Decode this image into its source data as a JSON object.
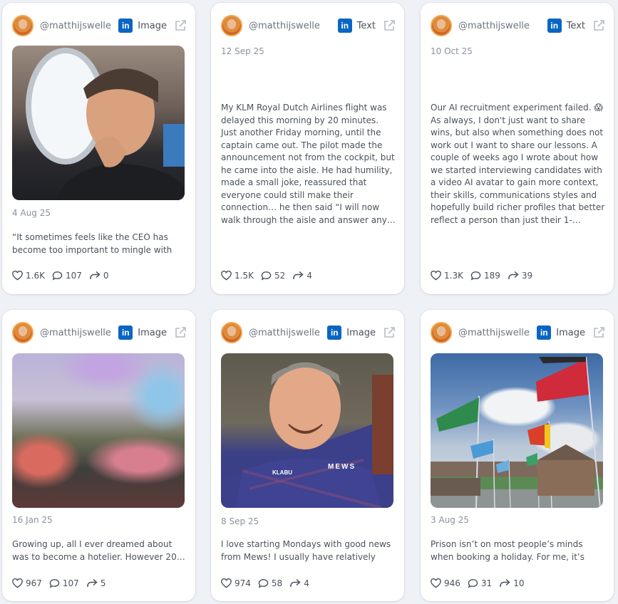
{
  "cards": [
    {
      "handle": "@matthijswelle",
      "type": "Image",
      "date": "4 Aug 25",
      "text": "“It sometimes feels like the CEO has become too important to mingle with th…",
      "likes": "1.6K",
      "comments": "107",
      "shares": "0",
      "image": "plane-window-portrait"
    },
    {
      "handle": "@matthijswelle",
      "type": "Text",
      "date": "12 Sep 25",
      "text": "My KLM Royal Dutch Airlines flight was delayed this morning by 20 minutes. Just another Friday morning, until the captain came out. The pilot made the announcement not from the cockpit, but he came into the aisle. He had humility, made a small joke, reassured that everyone could still make their connection… he then said “I will now walk through the aisle and answer any…",
      "likes": "1.5K",
      "comments": "52",
      "shares": "4"
    },
    {
      "handle": "@matthijswelle",
      "type": "Text",
      "date": "10 Oct 25",
      "text": "Our AI recruitment experiment failed. 😱 As always, I don't just want to share wins, but also when something does not work out I want to share our lessons. A couple of weeks ago I wrote about how we started interviewing candidates with a video AI avatar to gain more context, their skills, communications styles and hopefully build richer profiles that better reflect a person than just their 1-…",
      "likes": "1.3K",
      "comments": "189",
      "shares": "39"
    },
    {
      "handle": "@matthijswelle",
      "type": "Image",
      "date": "16 Jan 25",
      "text": "Growing up, all I ever dreamed about was to become a hotelier. However 20…",
      "likes": "967",
      "comments": "107",
      "shares": "5",
      "image": "blurred-photo"
    },
    {
      "handle": "@matthijswelle",
      "type": "Image",
      "date": "8 Sep 25",
      "text": "I love starting Mondays with good news from Mews! I usually have relatively goo…",
      "likes": "974",
      "comments": "58",
      "shares": "4",
      "image": "mews-shirt-portrait",
      "image_labels": [
        "KLABU",
        "MEWS"
      ]
    },
    {
      "handle": "@matthijswelle",
      "type": "Image",
      "date": "3 Aug 25",
      "text": "Prison isn’t on most people’s minds when booking a holiday. For me, it’s always a…",
      "likes": "946",
      "comments": "31",
      "shares": "10",
      "image": "flags-building"
    }
  ],
  "icons": {
    "linkedin": "in",
    "external": "external-link-icon",
    "like": "heart-icon",
    "comment": "comment-icon",
    "share": "share-icon"
  },
  "colors": {
    "background": "#eef1f5",
    "linkedin": "#0a66c2",
    "avatar_ring": "#f4a64a"
  }
}
